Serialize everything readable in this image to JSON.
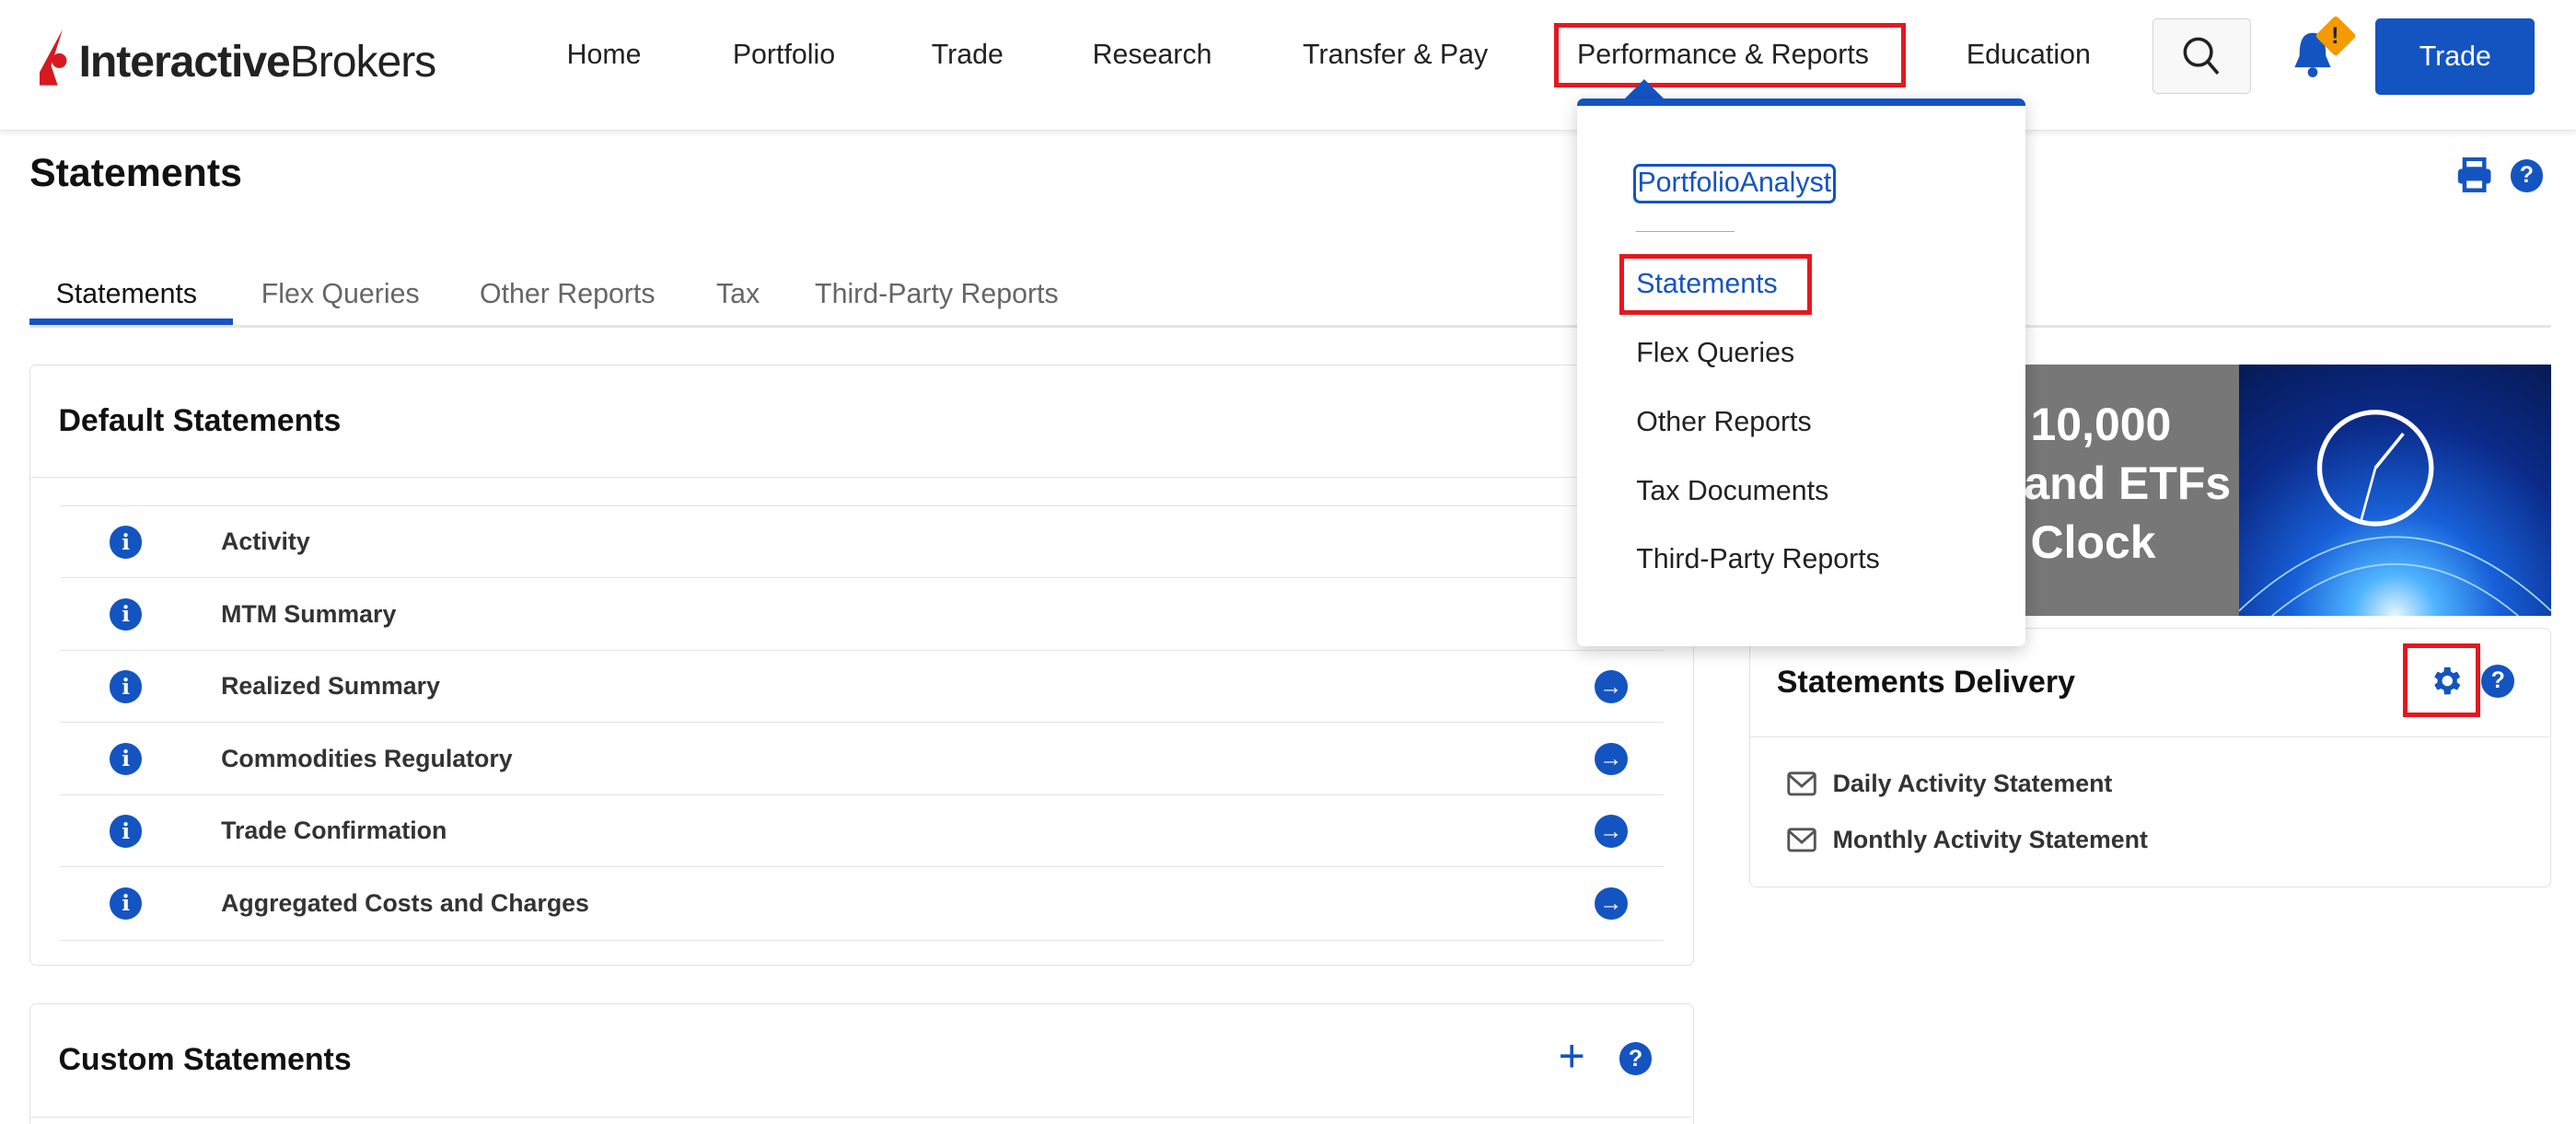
{
  "header": {
    "logo": {
      "text_bold": "Interactive",
      "text_regular": "Brokers"
    },
    "nav": [
      "Home",
      "Portfolio",
      "Trade",
      "Research",
      "Transfer & Pay",
      "Performance & Reports",
      "Education"
    ],
    "trade_button": "Trade",
    "notification_badge": "!"
  },
  "dropdown": {
    "portfolio_analyst": "PortfolioAnalyst",
    "items": [
      "Statements",
      "Flex Queries",
      "Other Reports",
      "Tax Documents",
      "Third-Party Reports"
    ]
  },
  "page": {
    "title": "Statements",
    "tabs": [
      "Statements",
      "Flex Queries",
      "Other Reports",
      "Tax",
      "Third-Party Reports"
    ]
  },
  "default_statements": {
    "title": "Default Statements",
    "rows": [
      "Activity",
      "MTM Summary",
      "Realized Summary",
      "Commodities Regulatory",
      "Trade Confirmation",
      "Aggregated Costs and Charges"
    ]
  },
  "custom_statements": {
    "title": "Custom Statements"
  },
  "banner": {
    "lines": [
      "10,000",
      "and ETFs",
      "Clock"
    ]
  },
  "delivery": {
    "title": "Statements Delivery",
    "items": [
      "Daily Activity Statement",
      "Monthly Activity Statement"
    ]
  },
  "colors": {
    "brand": "#1454c1",
    "annotation": "#e3191f",
    "logo_red": "#d71920"
  }
}
